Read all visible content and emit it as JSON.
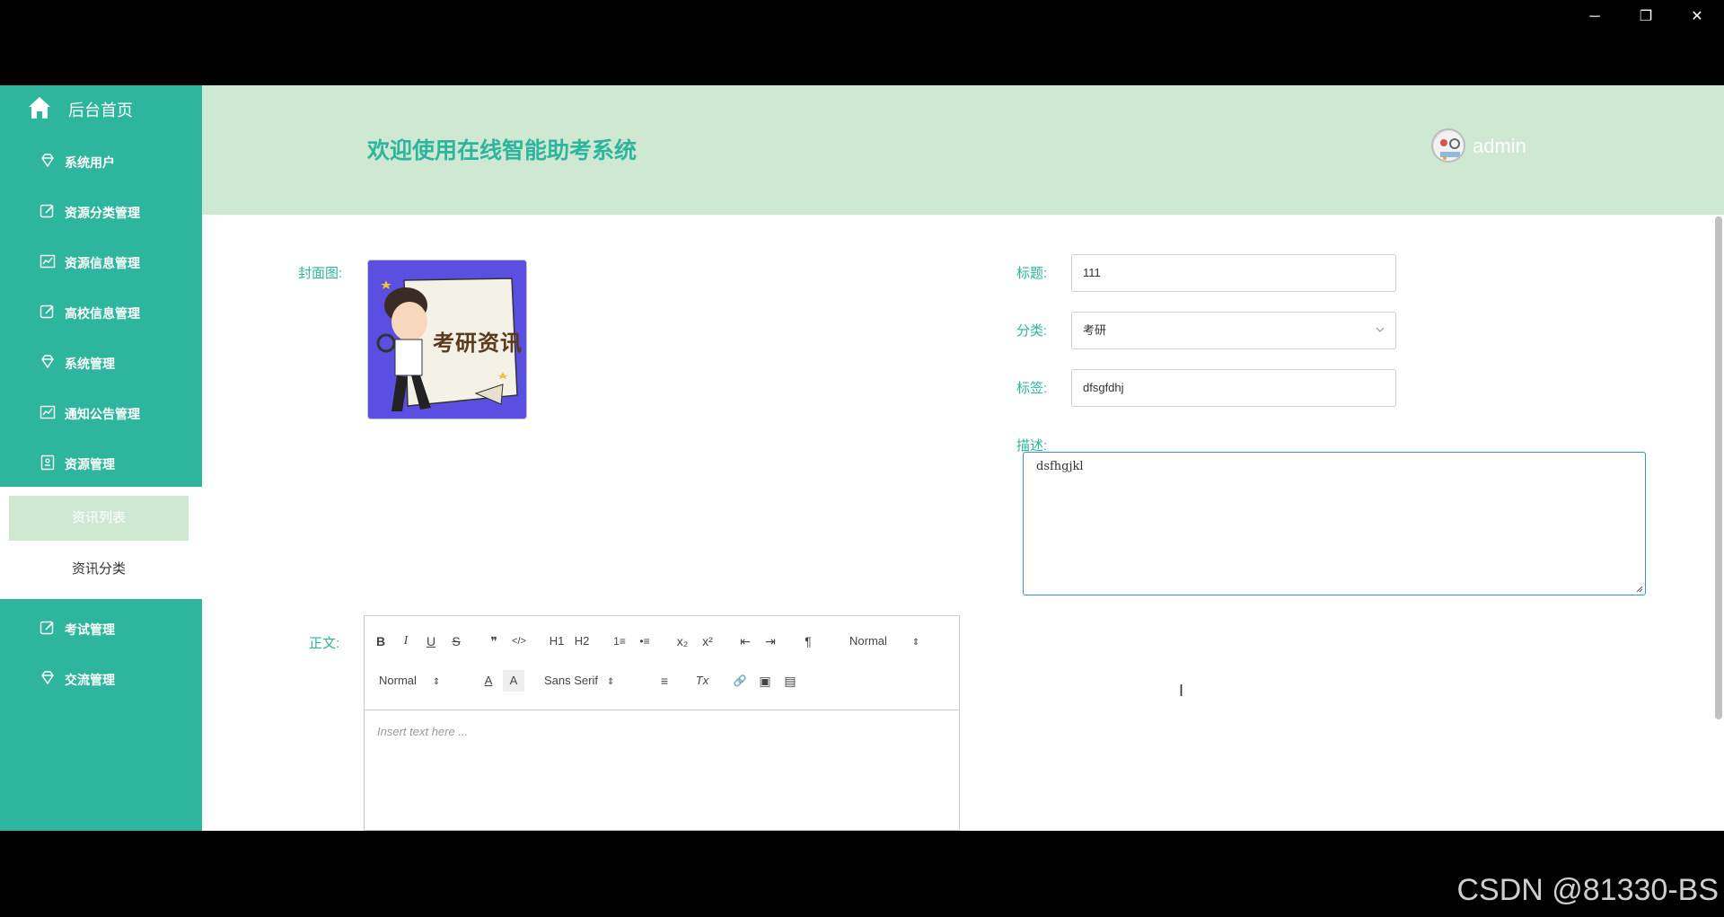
{
  "window": {
    "minimize": "─",
    "restore": "❐",
    "close": "✕"
  },
  "sidebar": {
    "home_label": "后台首页",
    "items": [
      {
        "label": "系统用户",
        "icon": "gem-icon"
      },
      {
        "label": "资源分类管理",
        "icon": "edit-icon"
      },
      {
        "label": "资源信息管理",
        "icon": "chart-icon"
      },
      {
        "label": "高校信息管理",
        "icon": "edit-icon"
      },
      {
        "label": "系统管理",
        "icon": "gem-icon"
      },
      {
        "label": "通知公告管理",
        "icon": "chart-icon"
      },
      {
        "label": "资源管理",
        "icon": "document-icon"
      },
      {
        "label": "考试管理",
        "icon": "edit-icon"
      },
      {
        "label": "交流管理",
        "icon": "gem-icon"
      }
    ],
    "submenu": [
      {
        "label": "资讯列表",
        "active": true
      },
      {
        "label": "资讯分类",
        "active": false
      }
    ]
  },
  "header": {
    "title": "欢迎使用在线智能助考系统",
    "username": "admin"
  },
  "form": {
    "cover_label": "封面图:",
    "cover_text": "考研资讯",
    "title_label": "标题:",
    "title_value": "111",
    "category_label": "分类:",
    "category_value": "考研",
    "tags_label": "标签:",
    "tags_value": "dfsgfdhj",
    "desc_label": "描述:",
    "desc_value": "dsfhgjkl",
    "body_label": "正文:",
    "editor": {
      "row1": [
        "B",
        "I",
        "U",
        "S",
        "❞",
        "</>",
        "H1",
        "H2",
        "1≡",
        "•≡",
        "x₂",
        "x²",
        "⇤",
        "⇥",
        "¶"
      ],
      "header_select": "Normal",
      "size_select": "Normal",
      "font_select": "Sans Serif",
      "row2_icons": [
        "A",
        "A",
        "≡",
        "Tx",
        "🔗",
        "▣",
        "▤"
      ],
      "placeholder": "Insert text here ..."
    }
  },
  "watermark": "CSDN @81330-BS",
  "colors": {
    "accent": "#2eb59d",
    "header_bg": "#cfe8d1",
    "focus": "#3b8fd6"
  }
}
